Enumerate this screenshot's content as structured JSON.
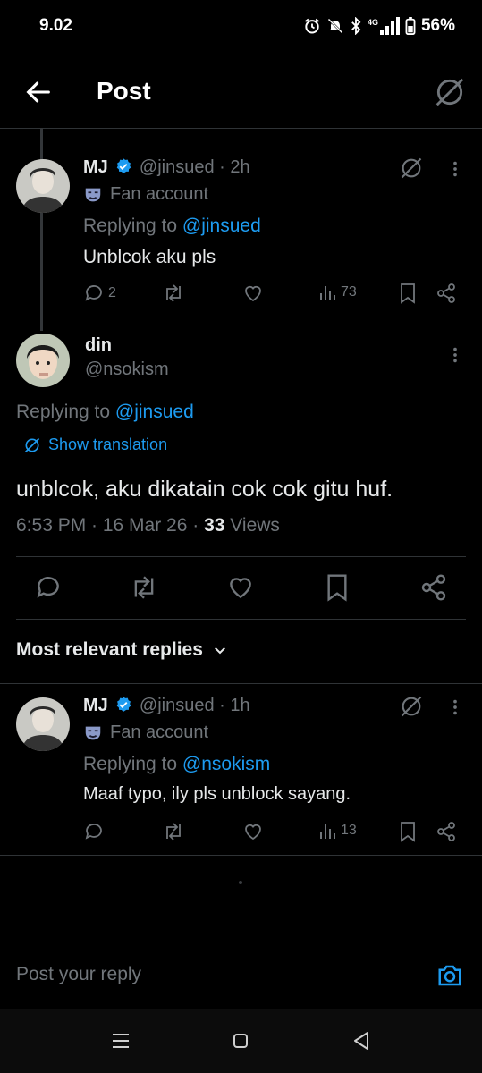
{
  "status_bar": {
    "time": "9.02",
    "net": "4G",
    "battery": "56%"
  },
  "header": {
    "title": "Post"
  },
  "reply1": {
    "name": "MJ",
    "handle": "@jinsued",
    "time": "· 2h",
    "badge": "Fan account",
    "replying_prefix": "Replying to",
    "replying_to": "@jinsued",
    "text": "Unblcok aku pls",
    "replies": "2",
    "views": "73"
  },
  "main": {
    "name": "din",
    "handle": "@nsokism",
    "replying_prefix": "Replying to",
    "replying_to": "@jinsued",
    "show_translation": "Show translation",
    "text": "unblcok, aku dikatain cok cok gitu huf.",
    "meta_time": "6:53 PM · 16 Mar 26 · ",
    "views_count": "33",
    "views_label": " Views"
  },
  "sort": {
    "label": "Most relevant replies"
  },
  "reply2": {
    "name": "MJ",
    "handle": "@jinsued",
    "time": "· 1h",
    "badge": "Fan account",
    "replying_prefix": "Replying to",
    "replying_to": "@nsokism",
    "text": "Maaf typo, ily pls unblock sayang.",
    "views": "13"
  },
  "composer": {
    "placeholder": "Post your reply"
  },
  "colors": {
    "accent": "#1d9bf0",
    "muted": "#71767b",
    "text": "#e7e9ea",
    "background": "#000000"
  }
}
